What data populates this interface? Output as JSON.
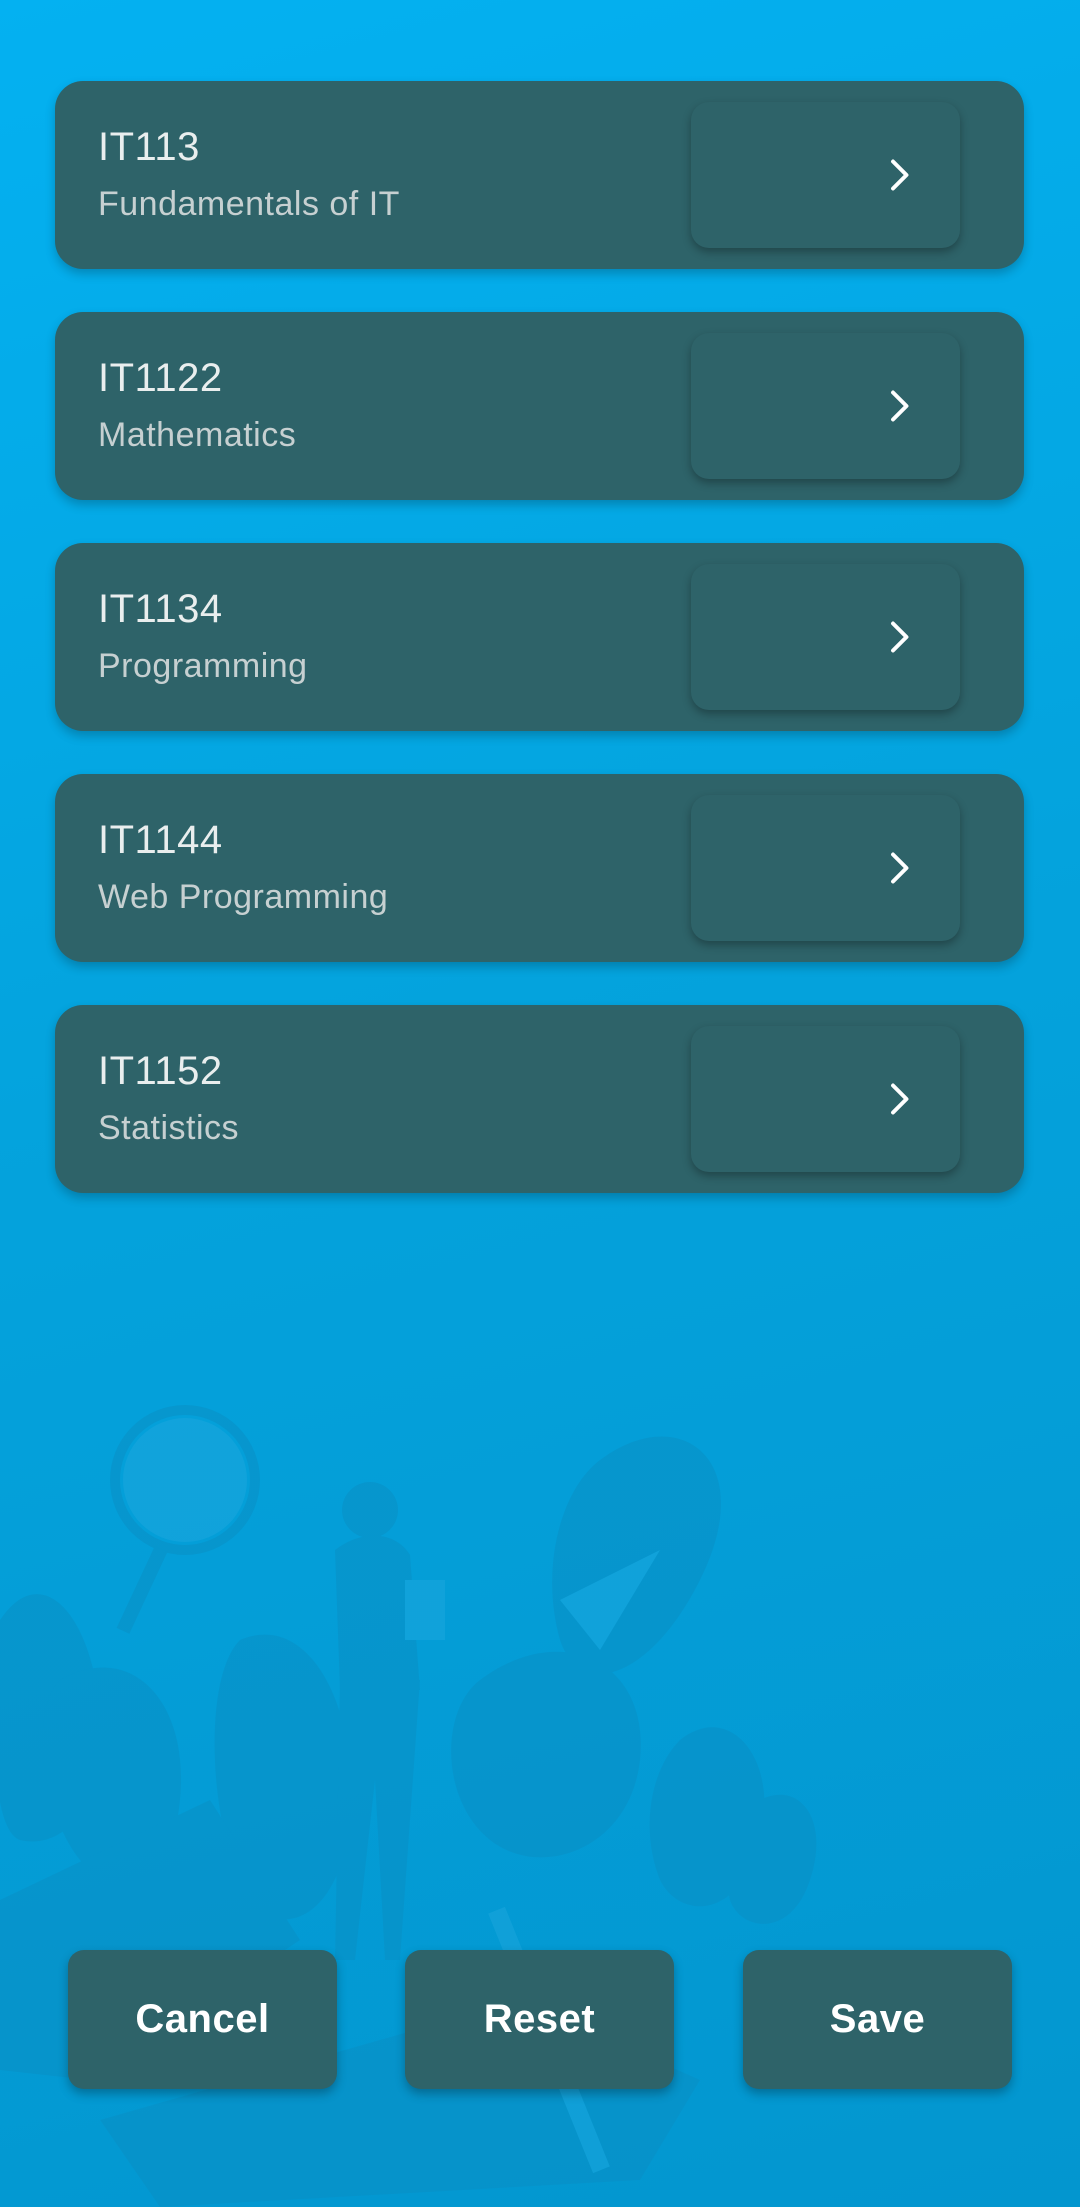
{
  "courses": [
    {
      "code": "IT113",
      "name": "Fundamentals of IT",
      "icon": "chevron-right-icon"
    },
    {
      "code": "IT1122",
      "name": "Mathematics",
      "icon": "chevron-right-icon"
    },
    {
      "code": "IT1134",
      "name": "Programming",
      "icon": "chevron-right-icon"
    },
    {
      "code": "IT1144",
      "name": "Web Programming",
      "icon": "chevron-right-icon"
    },
    {
      "code": "IT1152",
      "name": "Statistics",
      "icon": "chevron-right-icon"
    }
  ],
  "actions": {
    "cancel_label": "Cancel",
    "reset_label": "Reset",
    "save_label": "Save"
  },
  "colors": {
    "background_top": "#04b1f1",
    "background_bottom": "#0396cf",
    "card": "#2e6369",
    "text_primary": "#e9eeee",
    "text_secondary": "#c6d0d1"
  }
}
